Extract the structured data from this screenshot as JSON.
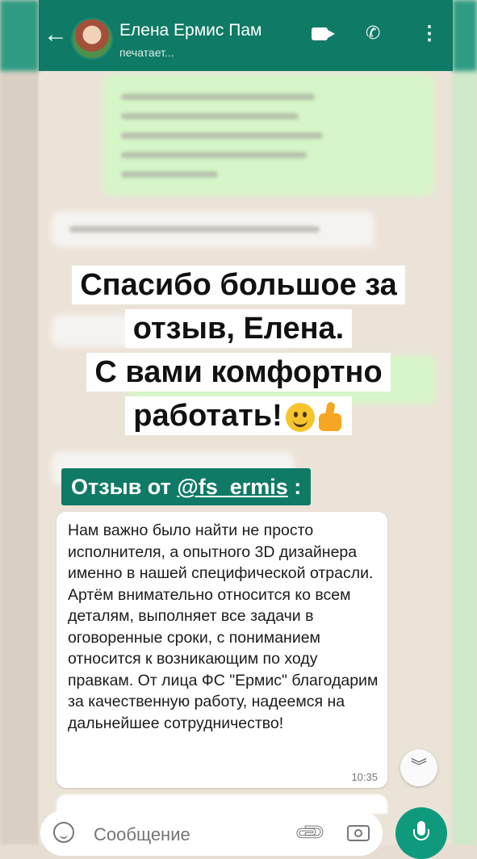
{
  "header": {
    "contact_name": "Елена Ермис Пам",
    "status": "печатает..."
  },
  "overlay": {
    "headline_lines": [
      "Спасибо большое за",
      "отзыв, Елена.",
      "С вами комфортно",
      "работать!"
    ],
    "emoji": [
      "smiley-face",
      "thumbs-up"
    ]
  },
  "review": {
    "label_prefix": "Отзыв от",
    "handle": "@fs_ermis",
    "label_suffix": ":"
  },
  "message": {
    "text": "Нам важно было найти не просто исполнителя, а опытного 3D дизайнера именно в нашей специфической отрасли. Артём внимательно относится ко всем деталям, выполняет все задачи в оговоренные сроки, с пониманием относится к возникающим по ходу правкам. От лица ФС \"Ермис\" благодарим за качественную работу, надеемся на дальнейшее сотрудничество!",
    "time": "10:35"
  },
  "composer": {
    "placeholder": "Сообщение"
  },
  "colors": {
    "header": "#0f7a66",
    "accent": "#0f9a7e"
  }
}
